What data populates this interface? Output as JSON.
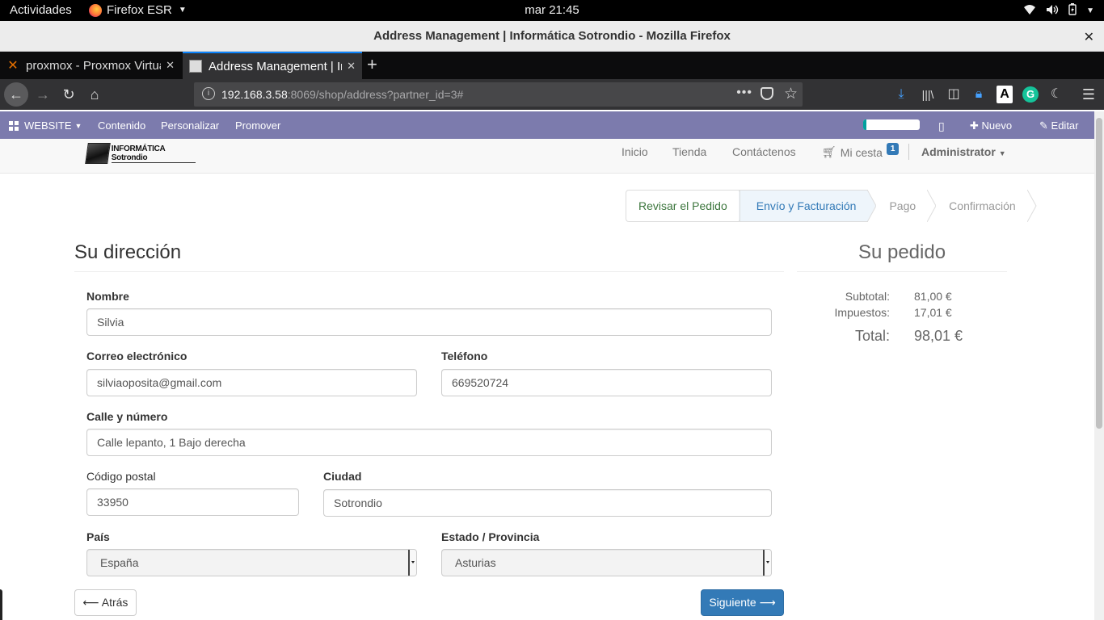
{
  "system": {
    "activities": "Actividades",
    "app_name": "Firefox ESR",
    "clock": "mar 21:45"
  },
  "window": {
    "title": "Address Management | Informática Sotrondio - Mozilla Firefox"
  },
  "tabs": [
    {
      "label": "proxmox - Proxmox Virtual Environment",
      "active": false
    },
    {
      "label": "Address Management | Informática Sotrondio",
      "active": true
    }
  ],
  "urlbar": {
    "host": "192.168.3.58",
    "rest": ":8069/shop/address?partner_id=3#"
  },
  "odoo_bar": {
    "website": "WEBSITE",
    "contenido": "Contenido",
    "personalizar": "Personalizar",
    "promover": "Promover",
    "progress": 0.05,
    "nuevo": "Nuevo",
    "editar": "Editar",
    "color": "#7c7bad"
  },
  "site": {
    "logo_text": "INFORMÁTICA Sotrondio",
    "nav": {
      "inicio": "Inicio",
      "tienda": "Tienda",
      "contactenos": "Contáctenos",
      "cart": "Mi cesta",
      "cart_count": "1",
      "user": "Administrator"
    }
  },
  "wizard": {
    "steps": [
      "Revisar el Pedido",
      "Envío y Facturación",
      "Pago",
      "Confirmación"
    ],
    "active_index": 1
  },
  "address": {
    "title": "Su dirección",
    "labels": {
      "name": "Nombre",
      "email": "Correo electrónico",
      "phone": "Teléfono",
      "street": "Calle y número",
      "zip": "Código postal",
      "city": "Ciudad",
      "country": "País",
      "state": "Estado / Provincia"
    },
    "values": {
      "name": "Silvia",
      "email": "silviaoposita@gmail.com",
      "phone": "669520724",
      "street": "Calle lepanto, 1 Bajo derecha",
      "zip": "33950",
      "city": "Sotrondio",
      "country": "España",
      "state": "Asturias"
    },
    "back_label": "Atrás",
    "next_label": "Siguiente"
  },
  "order": {
    "title": "Su pedido",
    "subtotal_label": "Subtotal:",
    "subtotal": "81,00 €",
    "taxes_label": "Impuestos:",
    "taxes": "17,01 €",
    "total_label": "Total:",
    "total": "98,01 €"
  }
}
